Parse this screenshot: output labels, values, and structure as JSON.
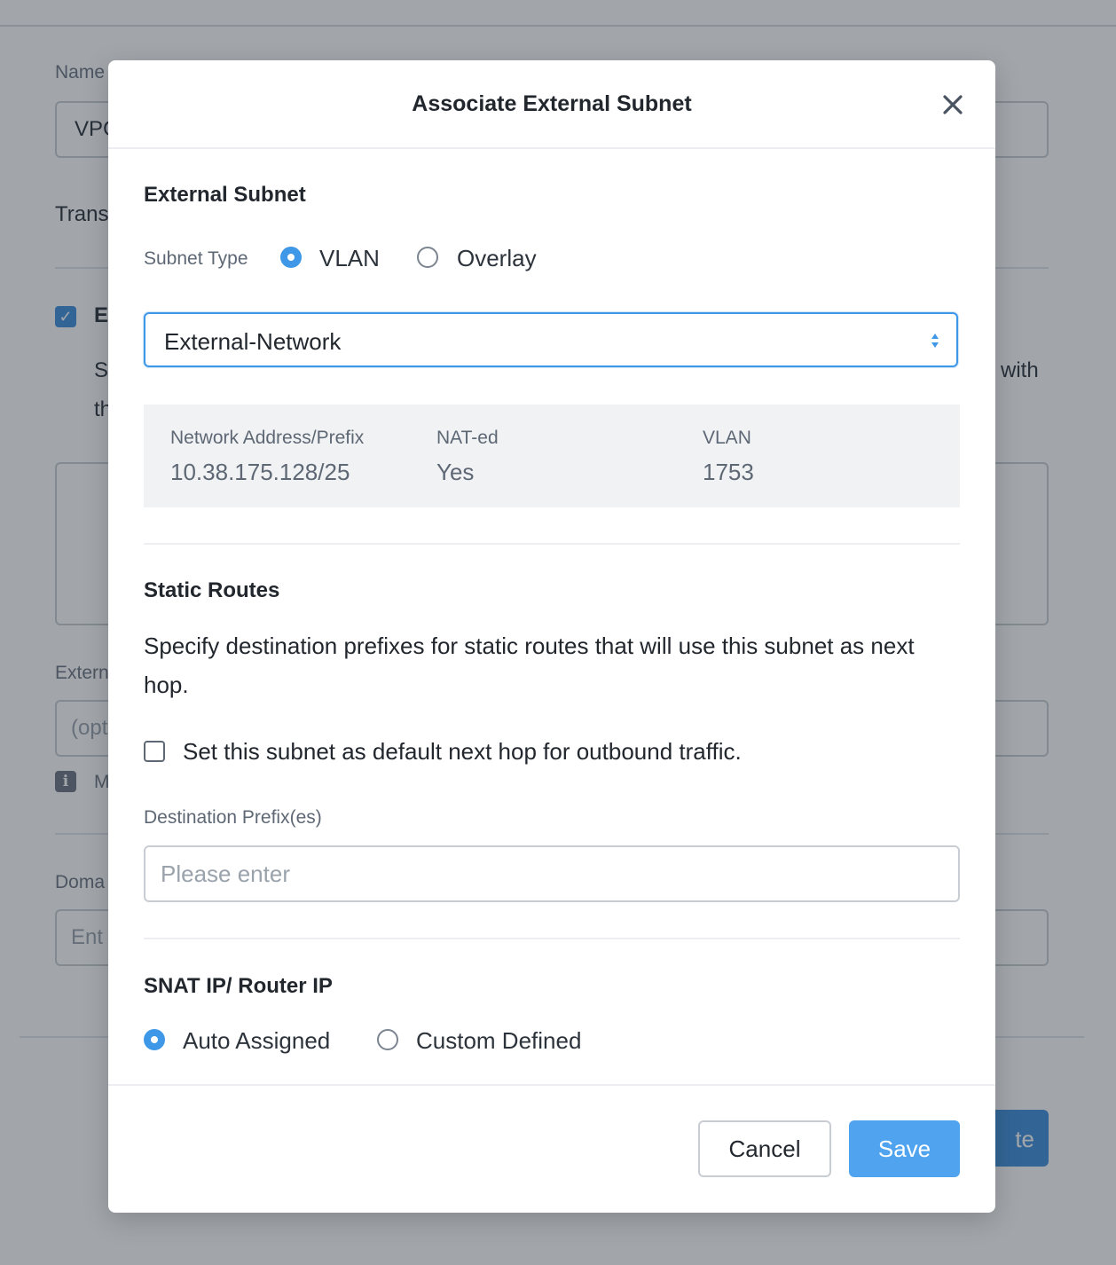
{
  "background": {
    "name_label": "Name",
    "name_value": "VPC",
    "transit_label": "Transit",
    "enable_label": "E",
    "desc_line1_start": "S",
    "desc_line1_end": "with",
    "desc_line2_start": "th",
    "external_label": "Extern",
    "external_placeholder": "(opt",
    "info_text": "M",
    "domain_label": "Doma",
    "domain_placeholder": "Ent",
    "create_button": "te"
  },
  "modal": {
    "title": "Associate External Subnet",
    "close_icon": "close-icon",
    "external_subnet": {
      "heading": "External Subnet",
      "subnet_type_label": "Subnet Type",
      "options": [
        {
          "label": "VLAN",
          "selected": true
        },
        {
          "label": "Overlay",
          "selected": false
        }
      ],
      "selected_network": "External-Network",
      "details": {
        "address_header": "Network Address/Prefix",
        "address_value": "10.38.175.128/25",
        "nat_header": "NAT-ed",
        "nat_value": "Yes",
        "vlan_header": "VLAN",
        "vlan_value": "1753"
      }
    },
    "static_routes": {
      "heading": "Static Routes",
      "description": "Specify destination prefixes for static routes that will use this subnet as next hop.",
      "default_hop_label": "Set this subnet as default next hop for outbound traffic.",
      "default_hop_checked": false,
      "destination_label": "Destination Prefix(es)",
      "destination_placeholder": "Please enter",
      "destination_value": ""
    },
    "snat": {
      "heading": "SNAT IP/ Router IP",
      "options": [
        {
          "label": "Auto Assigned",
          "selected": true
        },
        {
          "label": "Custom Defined",
          "selected": false
        }
      ]
    },
    "footer": {
      "cancel": "Cancel",
      "save": "Save"
    }
  },
  "colors": {
    "accent": "#3f97e8",
    "save_button": "#4fa3ef",
    "overlay": "#222a37"
  }
}
